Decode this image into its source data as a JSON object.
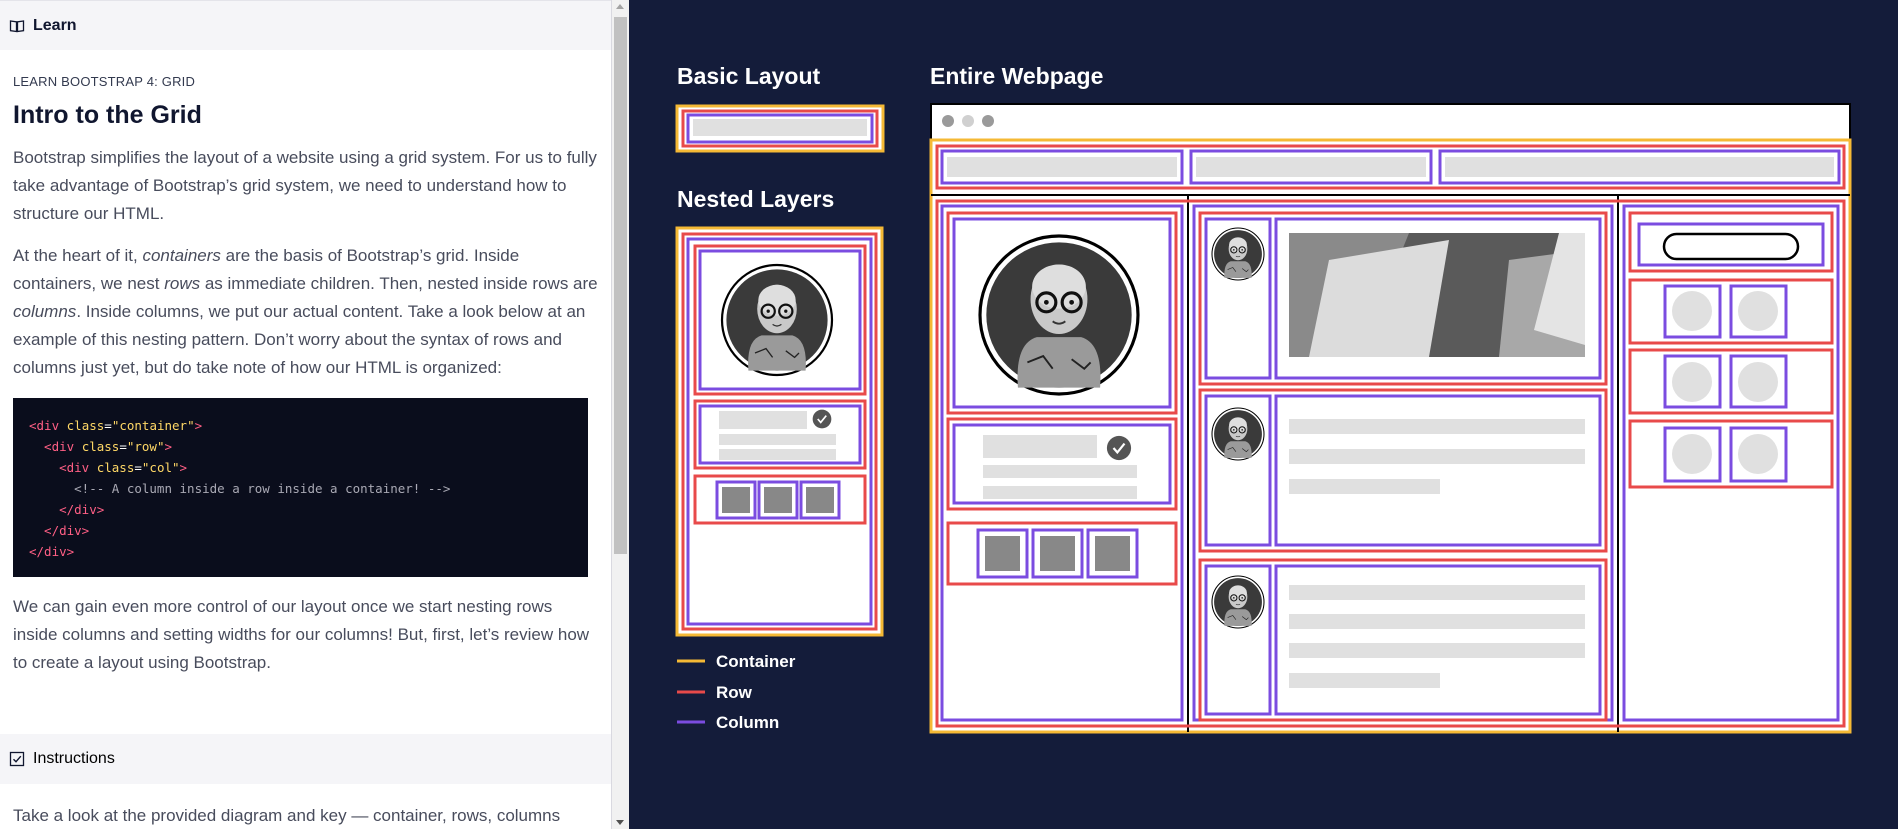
{
  "learn_panel": {
    "header_label": "Learn",
    "eyebrow": "LEARN BOOTSTRAP 4: GRID",
    "title": "Intro to the Grid",
    "intro": "Bootstrap simplifies the layout of a website using a grid system. For us to fully take advantage of Bootstrap’s grid system, we need to understand how to structure our HTML.",
    "p2": {
      "a": "At the heart of it, ",
      "containers": "containers",
      "b": " are the basis of Bootstrap’s grid. Inside containers, we nest ",
      "rows": "rows",
      "c": " as immediate children. Then, nested inside rows are ",
      "columns": "columns",
      "d": ". Inside columns, we put our actual content. Take a look below at an example of this nesting pattern. Don’t worry about the syntax of rows and columns just yet, but do take note of how our HTML is organized:"
    },
    "code": {
      "l1_open": "<div ",
      "l1_attr": "class",
      "l1_eq": "=",
      "l1_val": "\"container\"",
      "l1_close": ">",
      "l2_open": "  <div ",
      "l2_attr": "class",
      "l2_eq": "=",
      "l2_val": "\"row\"",
      "l2_close": ">",
      "l3_open": "    <div ",
      "l3_attr": "class",
      "l3_eq": "=",
      "l3_val": "\"col\"",
      "l3_close": ">",
      "l4": "      <!-- A column inside a row inside a container! -->",
      "l5": "    </div>",
      "l6": "  </div>",
      "l7": "</div>"
    },
    "p3": "We can gain even more control of our layout once we start nesting rows inside columns and setting widths for our columns! But, first, let’s review how to create a layout using Bootstrap.",
    "instructions_label": "Instructions",
    "instructions_text": "Take a look at the provided diagram and key — container, rows, columns"
  },
  "diagram": {
    "basic_layout_title": "Basic Layout",
    "nested_layers_title": "Nested Layers",
    "entire_webpage_title": "Entire Webpage",
    "legend": [
      {
        "label": "Container",
        "color": "#f5b935"
      },
      {
        "label": "Row",
        "color": "#e84a4a"
      },
      {
        "label": "Column",
        "color": "#7b4ce0"
      }
    ],
    "background": "#141c3a",
    "placeholder_color": "#e0e0e0"
  }
}
